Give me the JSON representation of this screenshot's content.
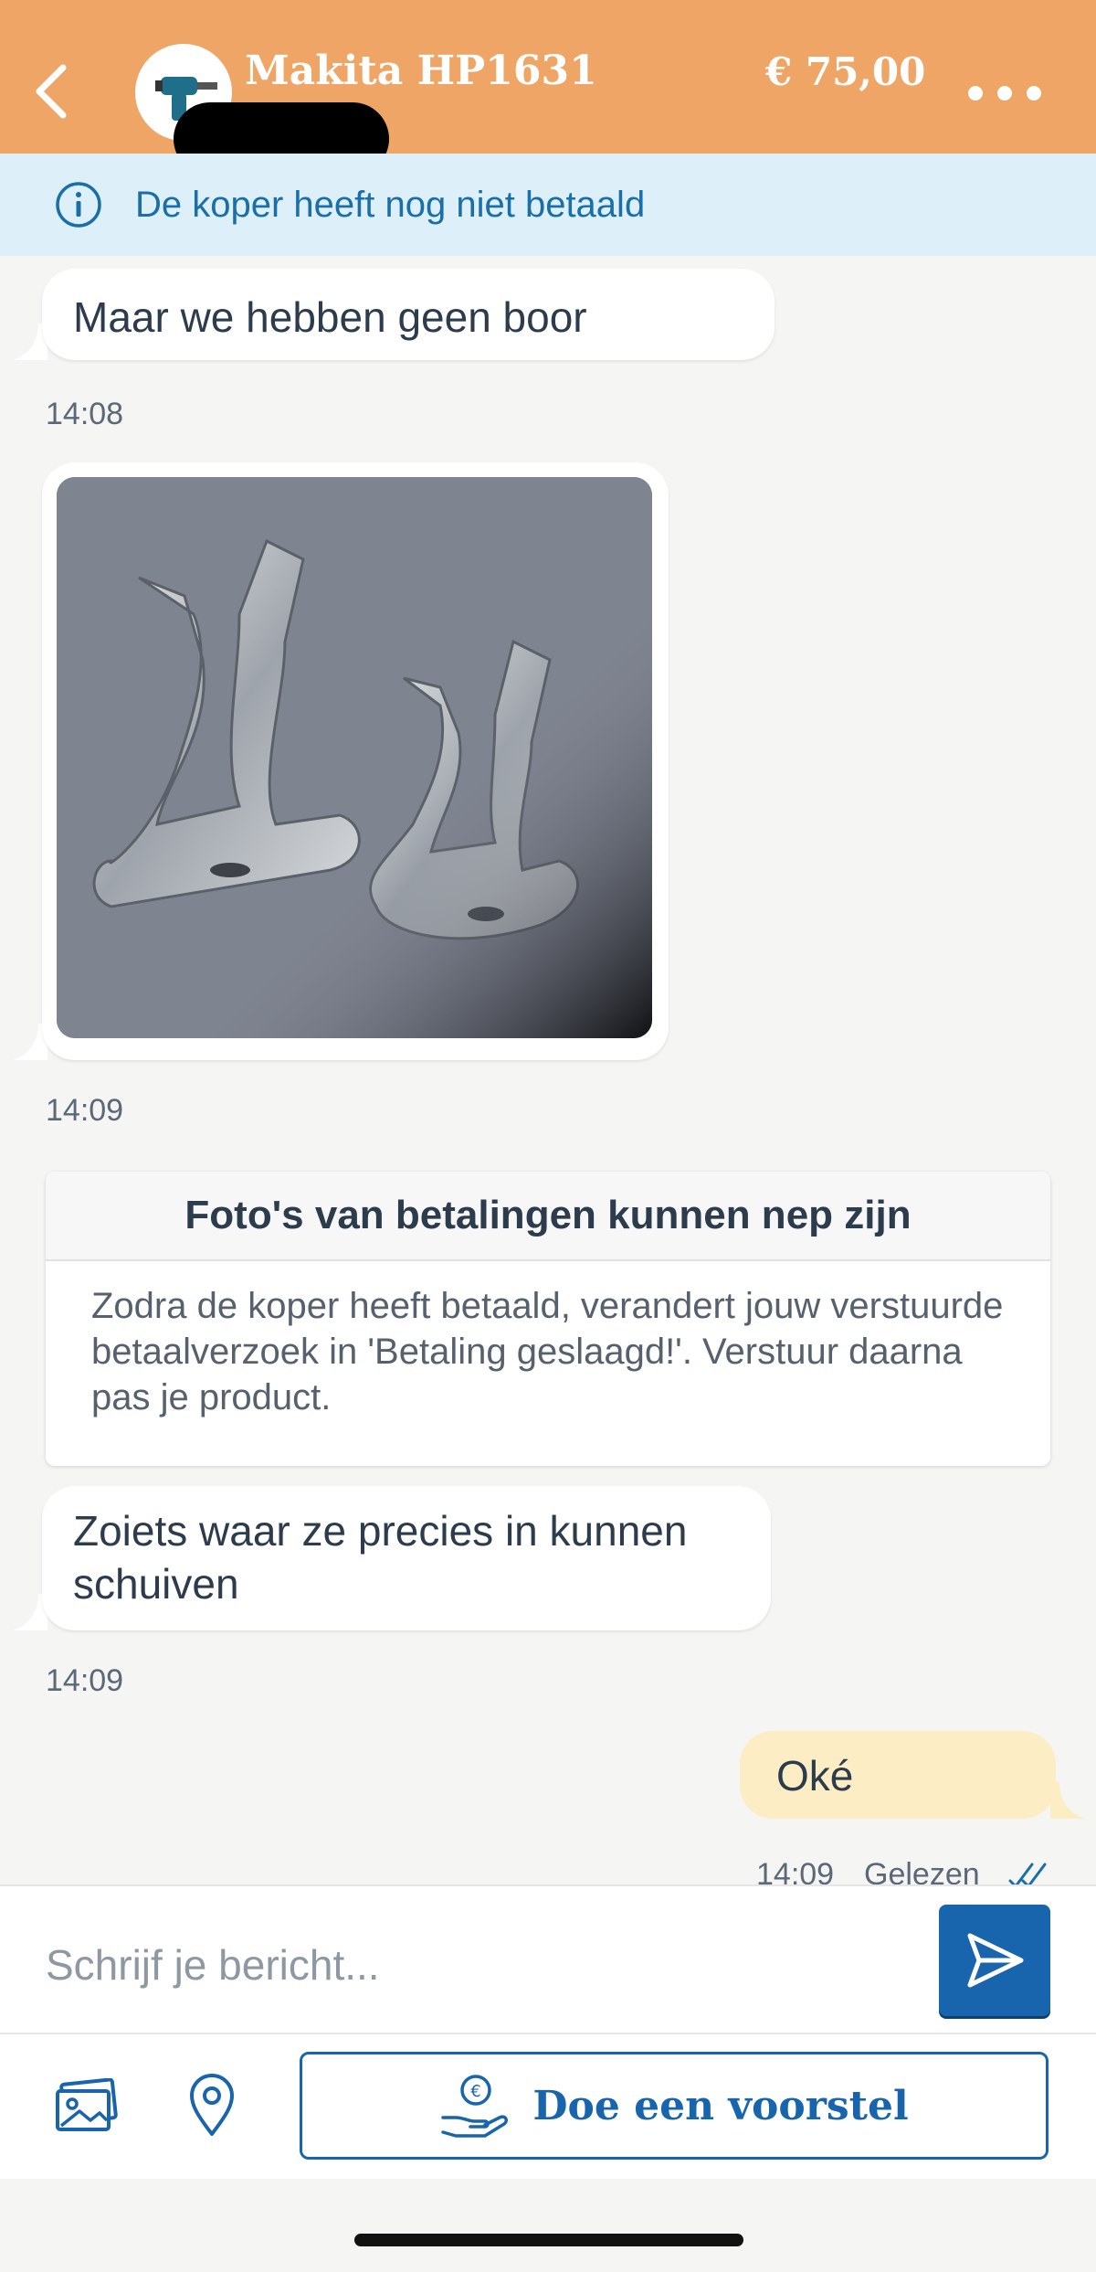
{
  "header": {
    "back_icon": "chevron-left-icon",
    "title": "Makita HP1631",
    "price": "€ 75,00",
    "more_icon": "more-dots-icon",
    "color": "#eea566"
  },
  "banner": {
    "icon": "info-icon",
    "text": "De koper heeft nog niet betaald"
  },
  "messages": [
    {
      "text": "Maar we hebben geen boor",
      "time": "14:08"
    },
    {
      "type": "image",
      "time": "14:09"
    },
    {
      "text": "Zoiets waar ze precies in kunnen schuiven",
      "time": "14:09"
    }
  ],
  "warning_card": {
    "title": "Foto's van betalingen kunnen nep zijn",
    "body": "Zodra de koper heeft betaald, verandert jouw verstuurde betaalverzoek in 'Betaling geslaagd!'. Verstuur daarna pas je product."
  },
  "outgoing": {
    "text": "Oké",
    "time": "14:09",
    "status": "Gelezen",
    "status_icon": "double-check-icon"
  },
  "composer": {
    "placeholder": "Schrijf je bericht...",
    "send_icon": "send-icon"
  },
  "toolbar": {
    "photo_icon": "photo-icon",
    "location_icon": "location-pin-icon",
    "offer_label": "Doe een voorstel",
    "offer_icon": "hand-coin-icon",
    "accent": "#1965ad"
  }
}
